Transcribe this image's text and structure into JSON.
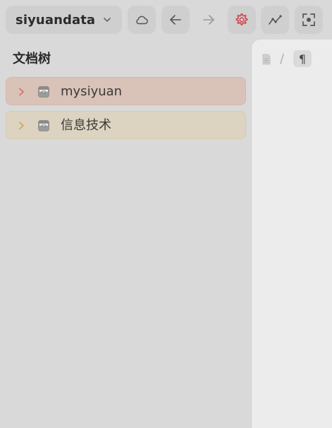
{
  "toolbar": {
    "workspace_name": "siyuandata",
    "buttons": [
      {
        "name": "cloud-sync",
        "icon": "cloud-icon"
      },
      {
        "name": "back",
        "icon": "arrow-left-icon"
      },
      {
        "name": "forward",
        "icon": "arrow-right-icon"
      },
      {
        "name": "settings",
        "icon": "gear-icon"
      },
      {
        "name": "graph",
        "icon": "trend-icon"
      },
      {
        "name": "focus",
        "icon": "focus-icon"
      }
    ]
  },
  "sidebar": {
    "title": "文档树",
    "notebooks": [
      {
        "label": "mysiyuan",
        "color": "#d9c2b8"
      },
      {
        "label": "信息技术",
        "color": "#dcd4c0"
      }
    ]
  },
  "editor": {
    "breadcrumb_sep": "/",
    "pilcrow": "¶"
  },
  "colors": {
    "accent_red": "#d9434f",
    "arrow_red": "#d5746a",
    "arrow_orange": "#d8a258"
  }
}
